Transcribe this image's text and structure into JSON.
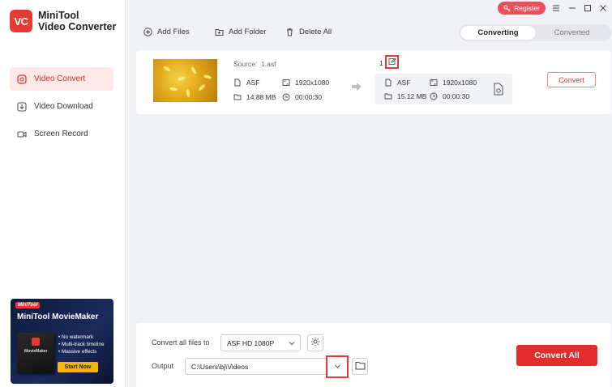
{
  "app": {
    "name_line1": "MiniTool",
    "name_line2": "Video Converter",
    "logo_text": "VC"
  },
  "topbar": {
    "register_label": "Register"
  },
  "sidebar": {
    "items": [
      {
        "label": "Video Convert",
        "icon": "convert-icon",
        "active": true
      },
      {
        "label": "Video Download",
        "icon": "download-icon",
        "active": false
      },
      {
        "label": "Screen Record",
        "icon": "camera-icon",
        "active": false
      }
    ],
    "promo": {
      "tag": "MiniTool",
      "title": "MiniTool MovieMaker",
      "box_label": "MovieMaker",
      "features": [
        "No watermark",
        "Multi-track timeline",
        "Massive effects"
      ],
      "button_label": "Start Now"
    }
  },
  "toolbar": {
    "add_files": "Add Files",
    "add_folder": "Add Folder",
    "delete_all": "Delete All",
    "tabs": [
      {
        "label": "Converting",
        "active": true
      },
      {
        "label": "Converted",
        "active": false
      }
    ]
  },
  "file": {
    "source_label": "Source:",
    "source_name": "1.asf",
    "source": {
      "format": "ASF",
      "resolution": "1920x1080",
      "size": "14.88 MB",
      "duration": "00:00:30"
    },
    "target_name": "1",
    "target": {
      "format": "ASF",
      "resolution": "1920x1080",
      "size": "15.12 MB",
      "duration": "00:00:30"
    },
    "convert_label": "Convert"
  },
  "bottom": {
    "convert_all_files_label": "Convert all files to",
    "format_value": "ASF HD 1080P",
    "output_label": "Output",
    "output_path": "C:\\Users\\bj\\Videos",
    "convert_all_label": "Convert All"
  },
  "colors": {
    "accent": "#e53935",
    "active_nav_bg": "#fde8e8",
    "background": "#f1f2f6"
  }
}
